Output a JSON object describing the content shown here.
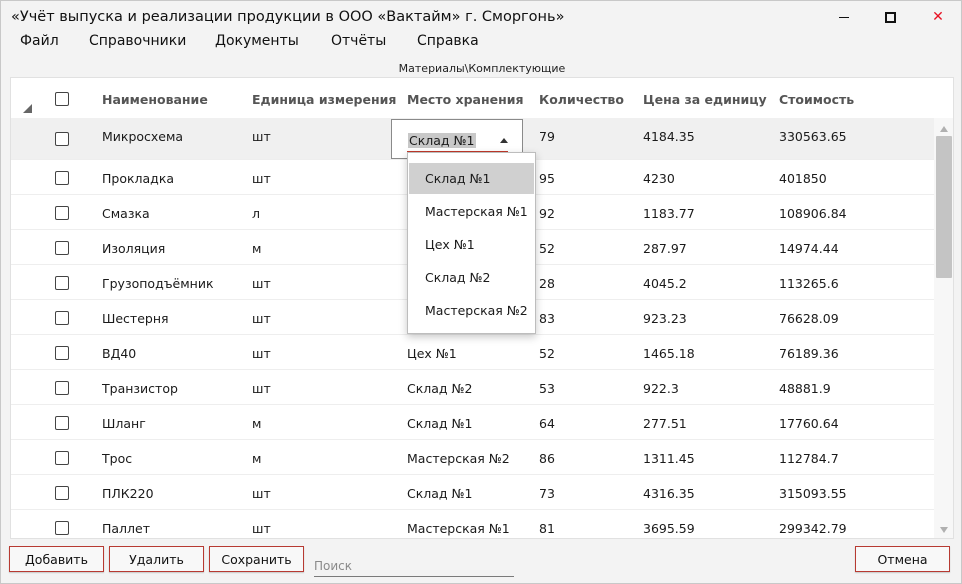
{
  "window": {
    "title": "«Учёт выпуска и реализации продукции в ООО «Вактайм» г. Сморгонь»",
    "close_glyph": "✕",
    "accent_color": "#b73a32"
  },
  "menu": [
    "Файл",
    "Справочники",
    "Документы",
    "Отчёты",
    "Справка"
  ],
  "caption": "Материалы\\Комплектующие",
  "columns": [
    "Наименование",
    "Единица измерения",
    "Место хранения",
    "Количество",
    "Цена за единицу",
    "Стоимость"
  ],
  "rows": [
    {
      "name": "Микросхема",
      "unit": "шт",
      "place": "Склад №1",
      "qty": "79",
      "price": "4184.35",
      "cost": "330563.65"
    },
    {
      "name": "Прокладка",
      "unit": "шт",
      "place": "",
      "qty": "95",
      "price": "4230",
      "cost": "401850"
    },
    {
      "name": "Смазка",
      "unit": "л",
      "place": "",
      "qty": "92",
      "price": "1183.77",
      "cost": "108906.84"
    },
    {
      "name": "Изоляция",
      "unit": "м",
      "place": "",
      "qty": "52",
      "price": "287.97",
      "cost": "14974.44"
    },
    {
      "name": "Грузоподъёмник",
      "unit": "шт",
      "place": "",
      "qty": "28",
      "price": "4045.2",
      "cost": "113265.6"
    },
    {
      "name": "Шестерня",
      "unit": "шт",
      "place": "",
      "qty": "83",
      "price": "923.23",
      "cost": "76628.09"
    },
    {
      "name": "ВД40",
      "unit": "шт",
      "place": "Цех №1",
      "qty": "52",
      "price": "1465.18",
      "cost": "76189.36"
    },
    {
      "name": "Транзистор",
      "unit": "шт",
      "place": "Склад №2",
      "qty": "53",
      "price": "922.3",
      "cost": "48881.9"
    },
    {
      "name": "Шланг",
      "unit": "м",
      "place": "Склад №1",
      "qty": "64",
      "price": "277.51",
      "cost": "17760.64"
    },
    {
      "name": "Трос",
      "unit": "м",
      "place": "Мастерская №2",
      "qty": "86",
      "price": "1311.45",
      "cost": "112784.7"
    },
    {
      "name": "ПЛК220",
      "unit": "шт",
      "place": "Склад №1",
      "qty": "73",
      "price": "4316.35",
      "cost": "315093.55"
    },
    {
      "name": "Паллет",
      "unit": "шт",
      "place": "Мастерская №1",
      "qty": "81",
      "price": "3695.59",
      "cost": "299342.79"
    }
  ],
  "dropdown": {
    "selected": "Склад №1",
    "options": [
      "Склад №1",
      "Мастерская №1",
      "Цех №1",
      "Склад №2",
      "Мастерская №2"
    ]
  },
  "buttons": {
    "add": "Добавить",
    "delete": "Удалить",
    "save": "Сохранить",
    "cancel": "Отмена"
  },
  "search": {
    "placeholder": "Поиск",
    "value": ""
  }
}
